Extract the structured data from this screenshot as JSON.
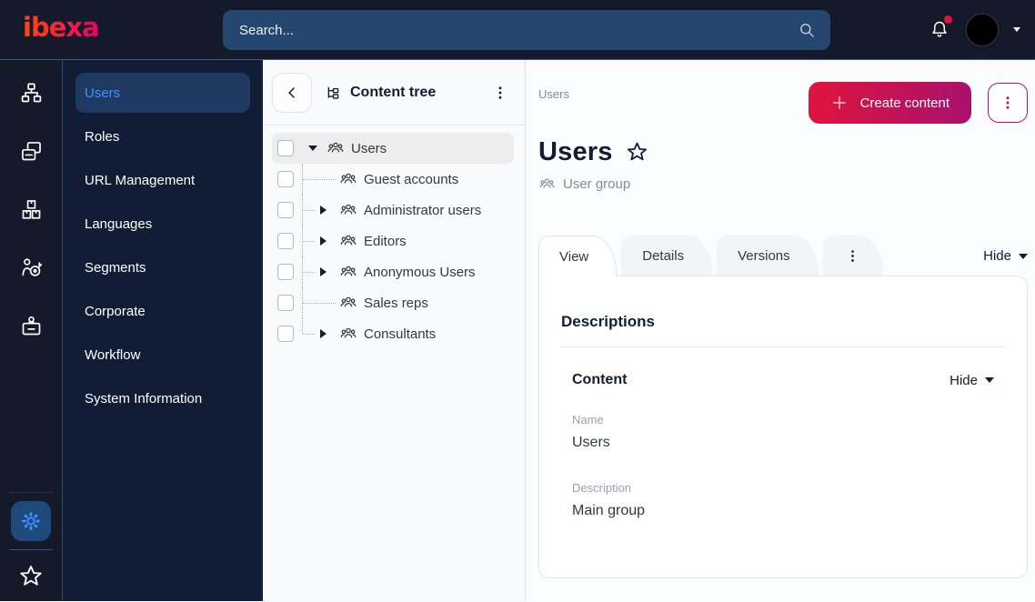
{
  "brand": {
    "logo_text": "ibexa",
    "gradient_start": "#ff4713",
    "gradient_end": "#eb0064"
  },
  "topbar": {
    "search_placeholder": "Search...",
    "bell_icon": "notifications",
    "has_notification_dot": true
  },
  "icon_rail": {
    "items": [
      {
        "icon": "content-structure-sitemap"
      },
      {
        "icon": "pages-cards"
      },
      {
        "icon": "commerce-boxes"
      },
      {
        "icon": "personalization-target-user"
      },
      {
        "icon": "admin-id-badge"
      }
    ],
    "settings": {
      "icon": "gear",
      "active": true
    },
    "bookmarks": {
      "icon": "star"
    }
  },
  "sidebar": {
    "items": [
      {
        "label": "Users",
        "active": true
      },
      {
        "label": "Roles"
      },
      {
        "label": "URL Management"
      },
      {
        "label": "Languages"
      },
      {
        "label": "Segments"
      },
      {
        "label": "Corporate"
      },
      {
        "label": "Workflow"
      },
      {
        "label": "System Information"
      }
    ]
  },
  "content_tree": {
    "title": "Content tree",
    "items": [
      {
        "label": "Users",
        "type": "user-group",
        "expanded": true,
        "has_children": true,
        "selected": true,
        "depth": 0
      },
      {
        "label": "Guest accounts",
        "type": "user-group",
        "has_children": false,
        "depth": 1
      },
      {
        "label": "Administrator users",
        "type": "user-group",
        "has_children": true,
        "depth": 1
      },
      {
        "label": "Editors",
        "type": "user-group",
        "has_children": true,
        "depth": 1
      },
      {
        "label": "Anonymous Users",
        "type": "user-group",
        "has_children": true,
        "depth": 1
      },
      {
        "label": "Sales reps",
        "type": "user-group",
        "has_children": false,
        "depth": 1
      },
      {
        "label": "Consultants",
        "type": "user-group",
        "has_children": true,
        "depth": 1,
        "last": true
      }
    ]
  },
  "main": {
    "breadcrumb": "Users",
    "create_button_label": "Create content",
    "title": "Users",
    "content_type_label": "User group",
    "tabs": [
      {
        "label": "View",
        "active": true
      },
      {
        "label": "Details"
      },
      {
        "label": "Versions"
      }
    ],
    "tabs_hide_label": "Hide",
    "section_heading": "Descriptions",
    "content_group": {
      "heading": "Content",
      "hide_label": "Hide",
      "fields": [
        {
          "label": "Name",
          "value": "Users"
        },
        {
          "label": "Description",
          "value": "Main group"
        }
      ]
    }
  },
  "colors": {
    "accent_blue": "#4191ff",
    "primary_red": "#e0143c",
    "magenta": "#a8116e",
    "notification_badge": "#e0143c",
    "topbar_bg": "#141a29",
    "sidebar_bg": "#101d35"
  }
}
